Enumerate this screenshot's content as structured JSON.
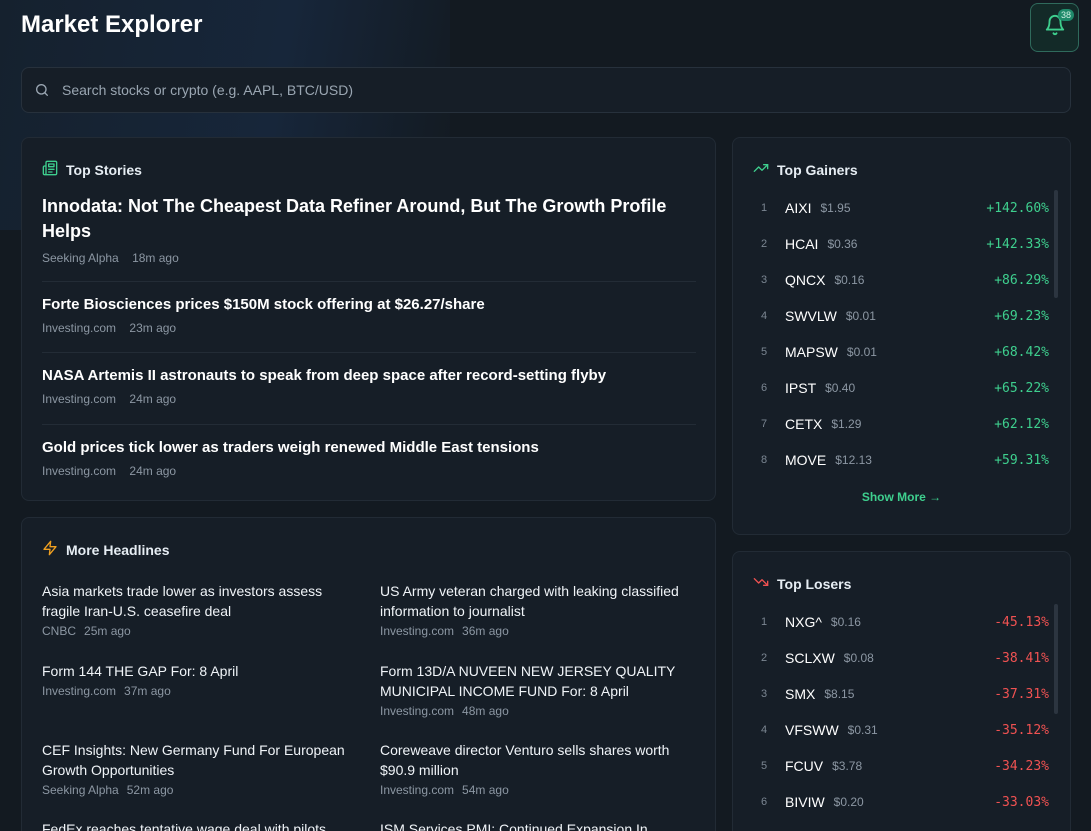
{
  "app": {
    "title": "Market Explorer"
  },
  "notifications": {
    "count": "38",
    "icon": "bell-icon"
  },
  "search": {
    "placeholder": "Search stocks or crypto (e.g. AAPL, BTC/USD)"
  },
  "colors": {
    "accent": "#3ecf8e",
    "negative": "#f05252",
    "background": "#131a21",
    "card": "#161e27"
  },
  "top_stories": {
    "header": "Top Stories",
    "lead": {
      "title": "Innodata: Not The Cheapest Data Refiner Around, But The Growth Profile Helps",
      "source": "Seeking Alpha",
      "time": "18m ago"
    },
    "items": [
      {
        "title": "Forte Biosciences prices $150M stock offering at $26.27/share",
        "source": "Investing.com",
        "time": "23m ago"
      },
      {
        "title": "NASA Artemis II astronauts to speak from deep space after record-setting flyby",
        "source": "Investing.com",
        "time": "24m ago"
      },
      {
        "title": "Gold prices tick lower as traders weigh renewed Middle East tensions",
        "source": "Investing.com",
        "time": "24m ago"
      }
    ]
  },
  "more_headlines": {
    "header": "More Headlines",
    "items": [
      {
        "title": "Asia markets trade lower as investors assess fragile Iran-U.S. ceasefire deal",
        "source": "CNBC",
        "time": "25m ago"
      },
      {
        "title": "US Army veteran charged with leaking classified information to journalist",
        "source": "Investing.com",
        "time": "36m ago"
      },
      {
        "title": "Form 144 THE GAP For: 8 April",
        "source": "Investing.com",
        "time": "37m ago"
      },
      {
        "title": "Form 13D/A NUVEEN NEW JERSEY QUALITY MUNICIPAL INCOME FUND For: 8 April",
        "source": "Investing.com",
        "time": "48m ago"
      },
      {
        "title": "CEF Insights: New Germany Fund For European Growth Opportunities",
        "source": "Seeking Alpha",
        "time": "52m ago"
      },
      {
        "title": "Coreweave director Venturo sells shares worth $90.9 million",
        "source": "Investing.com",
        "time": "54m ago"
      },
      {
        "title": "FedEx reaches tentative wage deal with pilots",
        "source": "",
        "time": ""
      },
      {
        "title": "ISM Services PMI: Continued Expansion In",
        "source": "",
        "time": ""
      }
    ]
  },
  "top_gainers": {
    "header": "Top Gainers",
    "show_more": "Show More →",
    "rows": [
      {
        "rank": "1",
        "symbol": "AIXI",
        "price": "$1.95",
        "change": "+142.60%"
      },
      {
        "rank": "2",
        "symbol": "HCAI",
        "price": "$0.36",
        "change": "+142.33%"
      },
      {
        "rank": "3",
        "symbol": "QNCX",
        "price": "$0.16",
        "change": "+86.29%"
      },
      {
        "rank": "4",
        "symbol": "SWVLW",
        "price": "$0.01",
        "change": "+69.23%"
      },
      {
        "rank": "5",
        "symbol": "MAPSW",
        "price": "$0.01",
        "change": "+68.42%"
      },
      {
        "rank": "6",
        "symbol": "IPST",
        "price": "$0.40",
        "change": "+65.22%"
      },
      {
        "rank": "7",
        "symbol": "CETX",
        "price": "$1.29",
        "change": "+62.12%"
      },
      {
        "rank": "8",
        "symbol": "MOVE",
        "price": "$12.13",
        "change": "+59.31%"
      }
    ]
  },
  "top_losers": {
    "header": "Top Losers",
    "rows": [
      {
        "rank": "1",
        "symbol": "NXG^",
        "price": "$0.16",
        "change": "-45.13%"
      },
      {
        "rank": "2",
        "symbol": "SCLXW",
        "price": "$0.08",
        "change": "-38.41%"
      },
      {
        "rank": "3",
        "symbol": "SMX",
        "price": "$8.15",
        "change": "-37.31%"
      },
      {
        "rank": "4",
        "symbol": "VFSWW",
        "price": "$0.31",
        "change": "-35.12%"
      },
      {
        "rank": "5",
        "symbol": "FCUV",
        "price": "$3.78",
        "change": "-34.23%"
      },
      {
        "rank": "6",
        "symbol": "BIVIW",
        "price": "$0.20",
        "change": "-33.03%"
      }
    ]
  }
}
